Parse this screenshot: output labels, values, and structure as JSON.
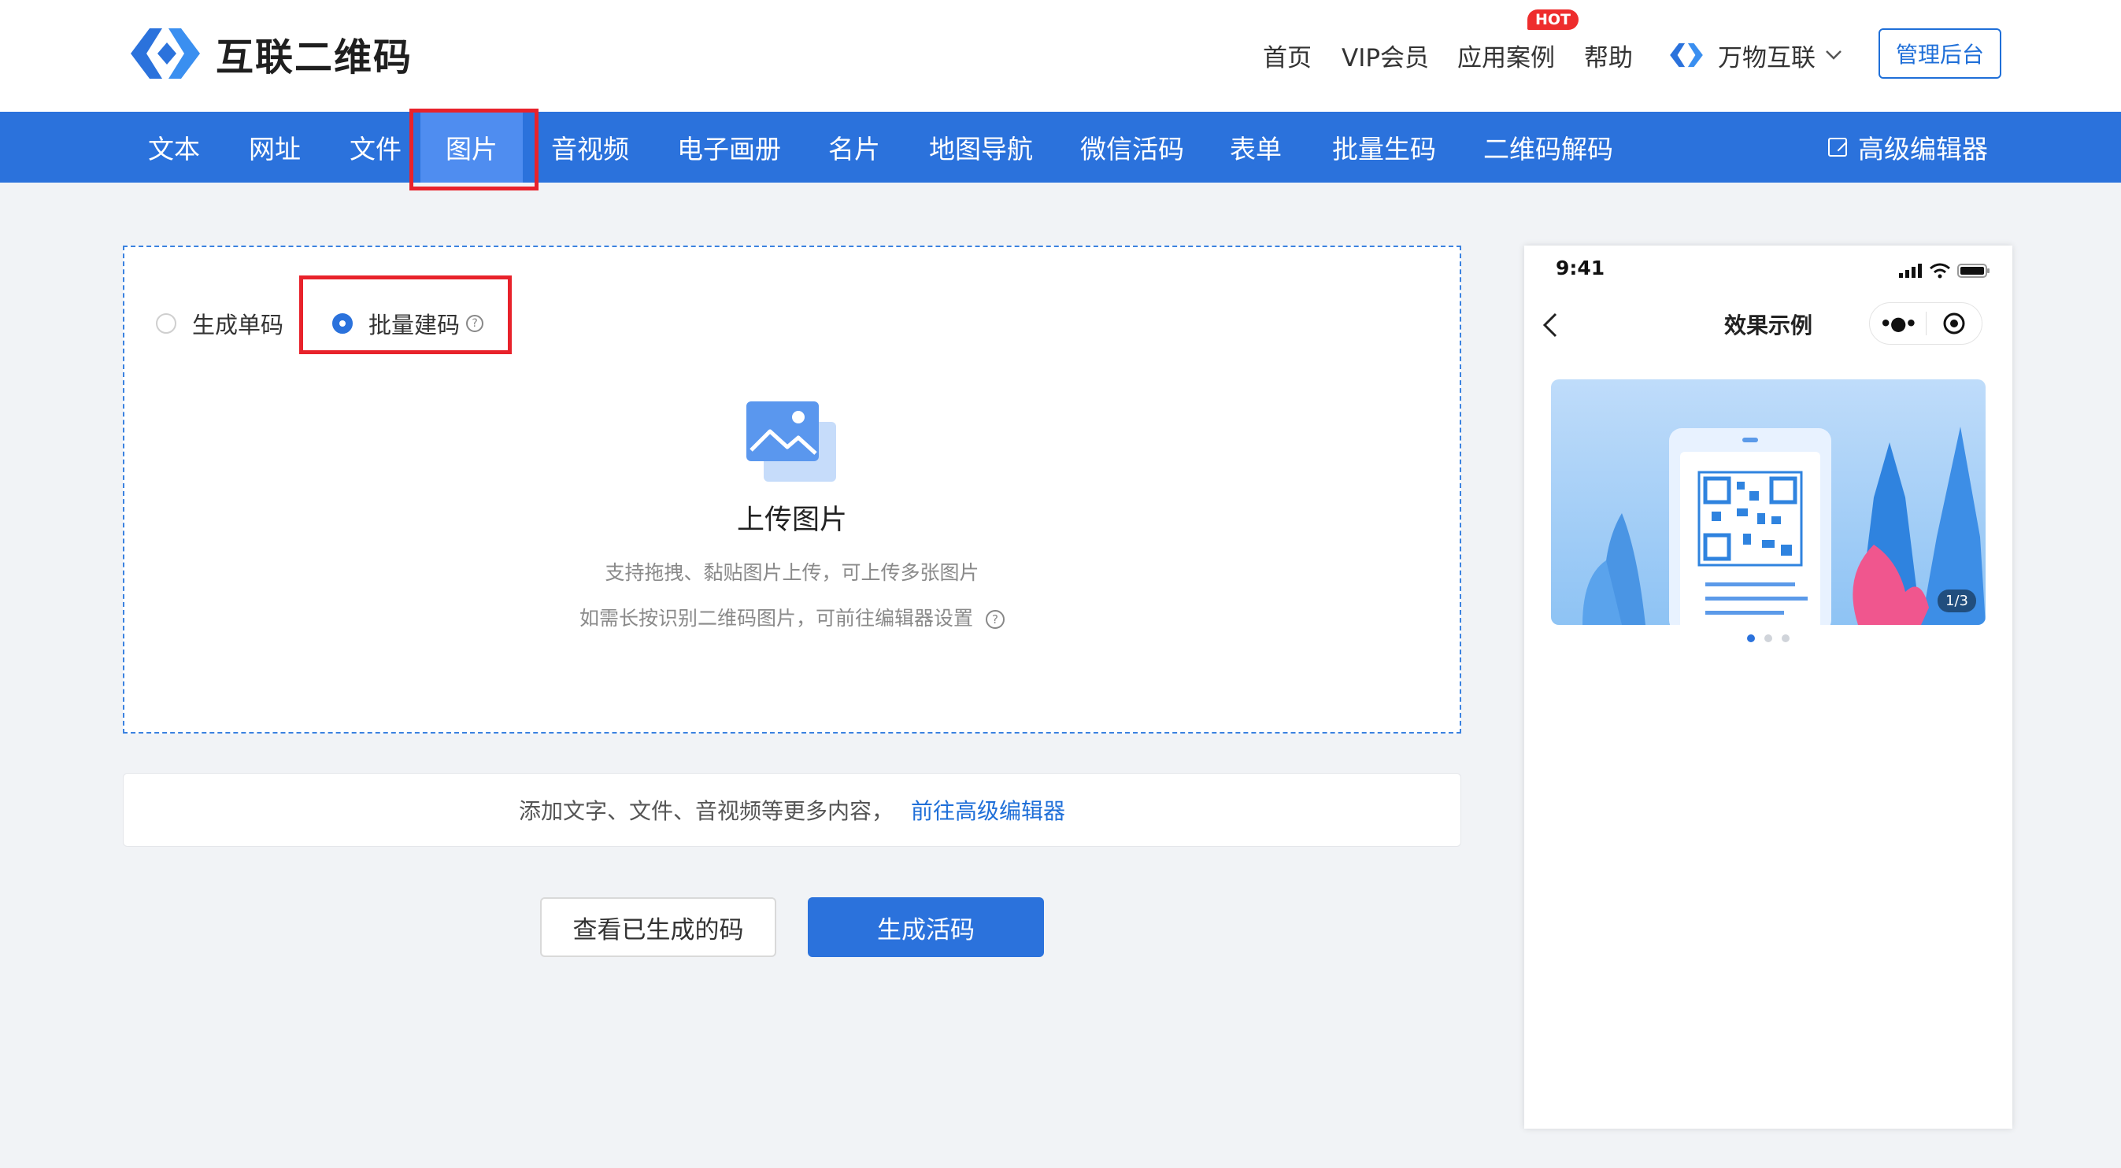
{
  "header": {
    "logo_text": "互联二维码",
    "nav": [
      {
        "label": "首页"
      },
      {
        "label": "VIP会员"
      },
      {
        "label": "应用案例",
        "badge": "HOT"
      },
      {
        "label": "帮助"
      }
    ],
    "org_name": "万物互联",
    "admin_label": "管理后台"
  },
  "tabs": [
    {
      "label": "文本"
    },
    {
      "label": "网址"
    },
    {
      "label": "文件"
    },
    {
      "label": "图片",
      "active": true
    },
    {
      "label": "音视频"
    },
    {
      "label": "电子画册"
    },
    {
      "label": "名片"
    },
    {
      "label": "地图导航"
    },
    {
      "label": "微信活码"
    },
    {
      "label": "表单"
    },
    {
      "label": "批量生码"
    },
    {
      "label": "二维码解码"
    }
  ],
  "advanced_editor_label": "高级编辑器",
  "mode": {
    "options": [
      {
        "label": "生成单码",
        "checked": false
      },
      {
        "label": "批量建码",
        "checked": true
      }
    ]
  },
  "upload": {
    "title": "上传图片",
    "hint1": "支持拖拽、黏贴图片上传，可上传多张图片",
    "hint2": "如需长按识别二维码图片，可前往编辑器设置"
  },
  "more_content": {
    "text": "添加文字、文件、音视频等更多内容，",
    "link": "前往高级编辑器"
  },
  "buttons": {
    "view_generated": "查看已生成的码",
    "generate": "生成活码"
  },
  "preview": {
    "time": "9:41",
    "title": "效果示例",
    "pager": "1/3",
    "slide_count": 3,
    "current_slide": 1
  },
  "colors": {
    "primary": "#2b72dc",
    "nav_active": "#4f8df0",
    "highlight_box": "#e8222b",
    "hot_badge": "#ee2d2d"
  },
  "icons": [
    "logo-icon",
    "chevron-down-icon",
    "edit-icon",
    "help-icon",
    "image-icon",
    "back-icon",
    "more-icon",
    "target-icon",
    "signal-icon",
    "wifi-icon",
    "battery-icon"
  ]
}
